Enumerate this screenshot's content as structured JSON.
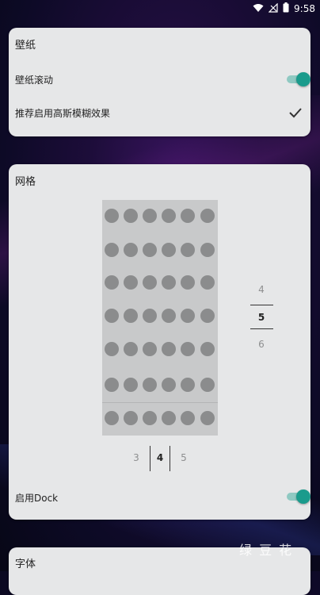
{
  "status_bar": {
    "time": "9:58",
    "icons": [
      "wifi-icon",
      "signal-icon",
      "battery-icon"
    ]
  },
  "wallpaper_card": {
    "title": "壁纸",
    "scroll_label": "壁纸滚动",
    "scroll_enabled": true,
    "blur_label": "推荐启用高斯模糊效果",
    "blur_checked": true
  },
  "grid_card": {
    "title": "网格",
    "rows_picker": {
      "prev": "4",
      "selected": "5",
      "next": "6"
    },
    "cols_picker": {
      "prev": "3",
      "selected": "4",
      "next": "5"
    },
    "dock_label": "启用Dock",
    "dock_enabled": true
  },
  "font_card": {
    "title": "字体"
  },
  "watermark": "绿 豆 花",
  "colors": {
    "accent": "#1a9b8c",
    "card": "#e6e7e8",
    "dot": "#8b8c8d"
  }
}
